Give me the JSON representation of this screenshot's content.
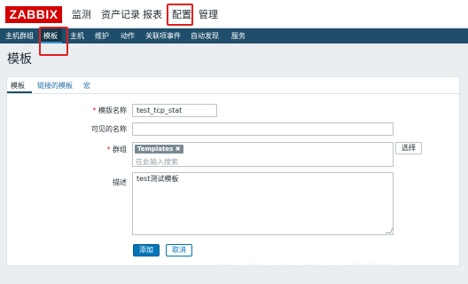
{
  "logo": "ZABBIX",
  "top_menu": {
    "monitoring": "监测",
    "inventory": "资产记录",
    "reports": "报表",
    "configuration": "配置",
    "administration": "管理"
  },
  "sub_menu": {
    "host_groups": "主机群组",
    "templates": "模板",
    "hosts": "主机",
    "maintenance": "维护",
    "actions": "动作",
    "correlation": "关联项事件",
    "discovery": "自动发现",
    "services": "服务"
  },
  "page_title": "模板",
  "tabs": {
    "template": "模板",
    "linked_templates": "链接的模板",
    "macros": "宏"
  },
  "form": {
    "required_mark": "*",
    "template_name_label": "模版名称",
    "template_name_value": "test_tcp_stat",
    "visible_name_label": "可见的名称",
    "visible_name_value": "",
    "groups_label": "群组",
    "group_chip": "Templates",
    "group_chip_remove": "✖",
    "groups_placeholder": "在此输入搜索",
    "select_button": "选择",
    "description_label": "描述",
    "description_value": "test测试模板",
    "add_button": "添加",
    "cancel_button": "取消"
  },
  "watermark": "https://blog.csdn.net/weixin_45012605",
  "colors": {
    "brand_red": "#d40000",
    "nav_bar": "#1f4e6a",
    "primary_button": "#0275b8",
    "highlight_box": "#e02020"
  }
}
